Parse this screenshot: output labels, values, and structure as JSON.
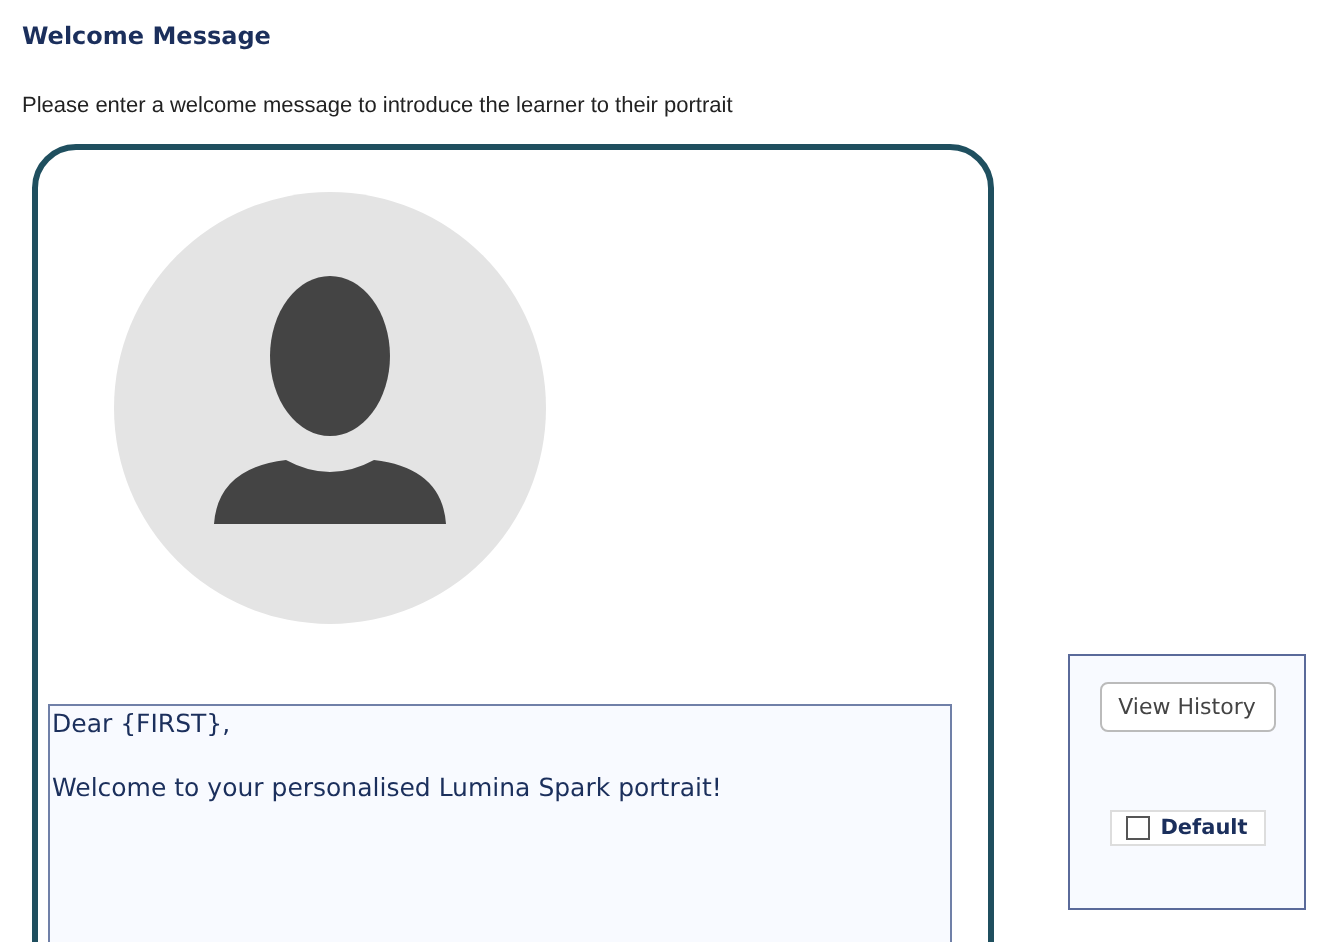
{
  "heading": "Welcome Message",
  "instructions": "Please enter a welcome message to introduce the learner to their portrait",
  "message": {
    "value": "Dear {FIRST},\n\nWelcome to your personalised Lumina Spark portrait!"
  },
  "side_panel": {
    "button": "View History",
    "default": {
      "label": "Default",
      "checked": false
    }
  }
}
